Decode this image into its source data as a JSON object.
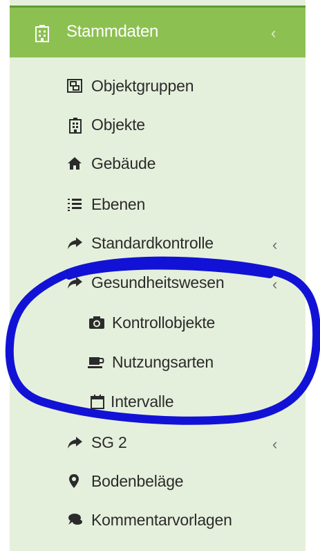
{
  "sidebar": {
    "header": {
      "label": "Stammdaten",
      "chevron": "‹",
      "icon": "building-icon"
    },
    "items": [
      {
        "label": "Objektgruppen",
        "icon": "object-group-icon",
        "chevron": ""
      },
      {
        "label": "Objekte",
        "icon": "building-icon",
        "chevron": ""
      },
      {
        "label": "Gebäude",
        "icon": "home-icon",
        "chevron": ""
      },
      {
        "label": "Ebenen",
        "icon": "list-ol-icon",
        "chevron": ""
      },
      {
        "label": "Standardkontrolle",
        "icon": "share-arrow-icon",
        "chevron": "‹"
      },
      {
        "label": "Gesundheitswesen",
        "icon": "share-arrow-icon",
        "chevron": "‹"
      },
      {
        "label": "Kontrollobjekte",
        "icon": "camera-icon",
        "chevron": ""
      },
      {
        "label": "Nutzungsarten",
        "icon": "coffee-cup-icon",
        "chevron": ""
      },
      {
        "label": "Intervalle",
        "icon": "calendar-icon",
        "chevron": ""
      },
      {
        "label": "SG 2",
        "icon": "share-arrow-icon",
        "chevron": "‹"
      },
      {
        "label": "Bodenbeläge",
        "icon": "map-marker-icon",
        "chevron": ""
      },
      {
        "label": "Kommentarvorlagen",
        "icon": "comments-icon",
        "chevron": ""
      }
    ]
  },
  "colors": {
    "header_bg": "#8cc152",
    "sidebar_bg": "#e5f0dc",
    "annotation_stroke": "#1212d6"
  }
}
